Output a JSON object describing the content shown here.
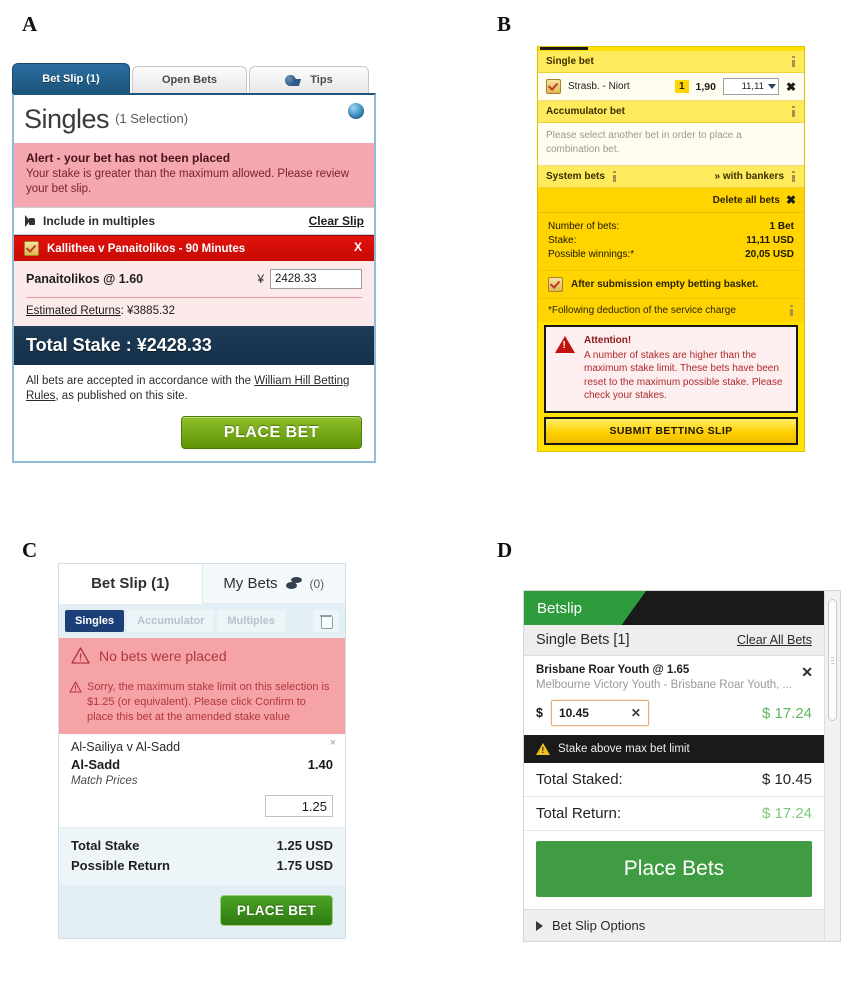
{
  "panels": {
    "a_letter": "A",
    "b_letter": "B",
    "c_letter": "C",
    "d_letter": "D"
  },
  "colors": {
    "accent_blue": "#1c557e",
    "alert_pink": "#f4a7ae",
    "selection_red": "#e2120c",
    "total_navy": "#1d3c56",
    "place_bet_green": "#5f9406",
    "yellow_bg": "#ffe200",
    "yellow_dark": "#ffd400",
    "panel_c_blue": "#e4eff5",
    "panel_d_green": "#3f9c42",
    "panel_d_black": "#1a1a1a"
  },
  "panel_a": {
    "tabs": [
      {
        "label": "Bet Slip (1)",
        "active": true
      },
      {
        "label": "Open Bets",
        "active": false
      },
      {
        "label": "Tips",
        "active": false,
        "icon": "dice-icon"
      }
    ],
    "title": "Singles",
    "subtitle": "(1 Selection)",
    "help_icon": "help-orb-icon",
    "alert_title": "Alert - your bet has not been placed",
    "alert_body": "Your stake is greater than the maximum allowed. Please review your bet slip.",
    "include_multiples": "Include in multiples",
    "clear_slip": "Clear Slip",
    "selection_header": "Kallithea v Panaitolikos - 90 Minutes",
    "selection_close": "X",
    "selection_name": "Panaitolikos @ 1.60",
    "currency_symbol": "¥",
    "stake_value": "2428.33",
    "estimated_returns_label": "Estimated Returns",
    "estimated_returns_value": ": ¥3885.32",
    "total_stake": "Total Stake : ¥2428.33",
    "footer_text_1": "All bets are accepted in accordance with the ",
    "footer_link": "William Hill Betting Rules",
    "footer_text_2": ", as published on this site.",
    "place_bet": "PLACE BET"
  },
  "panel_b": {
    "single_bet_header": "Single bet",
    "bet_team": "Strasb. - Niort",
    "bet_number": "1",
    "bet_odds": "1,90",
    "bet_stake": "11,11",
    "bet_remove": "✖",
    "accumulator_header": "Accumulator bet",
    "accumulator_empty": "Please select another bet in order to place a combination bet.",
    "system_bets": "System bets",
    "with_bankers": "» with bankers",
    "delete_all": "Delete all bets",
    "summary": [
      {
        "label": "Number of bets:",
        "value": "1 Bet"
      },
      {
        "label": "Stake:",
        "value": "11,11 USD"
      },
      {
        "label": "Possible winnings:*",
        "value": "20,05 USD"
      }
    ],
    "empty_basket": "After submission empty betting basket.",
    "service_charge_note": "*Following deduction of the service charge",
    "attention_title": "Attention!",
    "attention_body": "A number of stakes are higher than the maximum stake limit. These bets have been reset to the maximum possible stake. Please check your stakes.",
    "submit": "SUBMIT BETTING SLIP"
  },
  "panel_c": {
    "tabs": [
      {
        "label": "Bet Slip (1)",
        "active": true
      },
      {
        "label": "My Bets",
        "count": "(0)",
        "active": false,
        "icon": "coins-icon"
      }
    ],
    "subtabs": [
      {
        "label": "Singles",
        "active": true
      },
      {
        "label": "Accumulator",
        "active": false
      },
      {
        "label": "Multiples",
        "active": false
      }
    ],
    "trash_icon": "trash-icon",
    "no_bets": "No bets were placed",
    "warning": "Sorry, the maximum stake limit on this selection is $1.25 (or equivalent). Please click Confirm to place this bet at the amended stake value",
    "selection": {
      "match": "Al-Sailiya v Al-Sadd",
      "pick": "Al-Sadd",
      "odds": "1.40",
      "market": "Match Prices",
      "stake": "1.25",
      "close": "×"
    },
    "totals": [
      {
        "label": "Total Stake",
        "value": "1.25 USD"
      },
      {
        "label": "Possible Return",
        "value": "1.75 USD"
      }
    ],
    "place_bet": "PLACE BET"
  },
  "panel_d": {
    "header_title": "Betslip",
    "single_bets": "Single Bets [1]",
    "clear_all": "Clear All Bets",
    "bet": {
      "selection": "Brisbane Roar Youth @ 1.65",
      "event": "Melbourne Victory Youth - Brisbane Roar Youth, ...",
      "currency": "$",
      "stake": "10.45",
      "clear_stake": "✕",
      "return": "$ 17.24",
      "close": "✕"
    },
    "warning": "Stake above max bet limit",
    "totals": [
      {
        "label": "Total Staked:",
        "value": "$ 10.45",
        "green": false
      },
      {
        "label": "Total Return:",
        "value": "$ 17.24",
        "green": true
      }
    ],
    "place_bets": "Place Bets",
    "options": "Bet Slip Options"
  }
}
